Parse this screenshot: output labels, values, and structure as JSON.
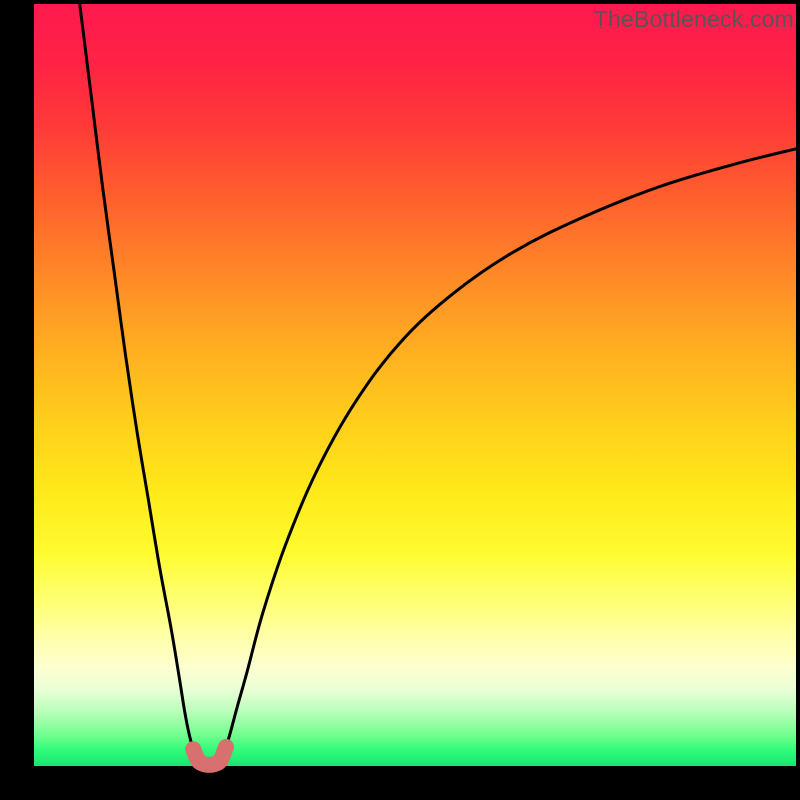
{
  "watermark": "TheBottleneck.com",
  "chart_data": {
    "type": "line",
    "title": "",
    "xlabel": "",
    "ylabel": "",
    "xlim": [
      0,
      100
    ],
    "ylim": [
      0,
      100
    ],
    "gradient_stops": [
      {
        "pct": 0,
        "color": "#ff1950"
      },
      {
        "pct": 8,
        "color": "#ff2344"
      },
      {
        "pct": 16,
        "color": "#ff3a38"
      },
      {
        "pct": 24,
        "color": "#ff5a2e"
      },
      {
        "pct": 32,
        "color": "#ff7a29"
      },
      {
        "pct": 40,
        "color": "#ff9a25"
      },
      {
        "pct": 48,
        "color": "#ffb81f"
      },
      {
        "pct": 56,
        "color": "#ffd21b"
      },
      {
        "pct": 64,
        "color": "#ffe91a"
      },
      {
        "pct": 72,
        "color": "#fffb30"
      },
      {
        "pct": 78,
        "color": "#ffff70"
      },
      {
        "pct": 83,
        "color": "#ffffa8"
      },
      {
        "pct": 87,
        "color": "#fdffd0"
      },
      {
        "pct": 90,
        "color": "#e9ffd6"
      },
      {
        "pct": 93,
        "color": "#b6ffb8"
      },
      {
        "pct": 96,
        "color": "#70ff8e"
      },
      {
        "pct": 98,
        "color": "#2dfb7a"
      },
      {
        "pct": 100,
        "color": "#19e56f"
      }
    ],
    "series": [
      {
        "name": "left-branch",
        "x": [
          6.0,
          7.5,
          9.0,
          10.5,
          12.0,
          13.5,
          15.0,
          16.5,
          18.0,
          19.0,
          19.8,
          20.4,
          20.9,
          21.3
        ],
        "values": [
          100,
          88,
          76,
          65,
          54,
          44,
          35,
          26,
          18,
          12,
          7,
          4,
          2.2,
          1.2
        ]
      },
      {
        "name": "right-branch",
        "x": [
          24.7,
          25.2,
          25.8,
          26.6,
          28.0,
          30.0,
          33.0,
          37.0,
          42.0,
          48.0,
          55.0,
          63.0,
          72.0,
          82.0,
          92.0,
          100.0
        ],
        "values": [
          1.2,
          2.5,
          4.5,
          7.5,
          12.5,
          20.0,
          29.0,
          38.5,
          47.5,
          55.5,
          62.0,
          67.5,
          72.0,
          76.0,
          79.0,
          81.0
        ]
      }
    ],
    "trough_marker": {
      "name": "trough",
      "color": "#d8706f",
      "x": [
        20.9,
        21.3,
        21.3,
        21.7,
        22.3,
        23.0,
        23.7,
        24.3,
        24.7,
        24.7,
        25.2
      ],
      "values": [
        2.2,
        1.2,
        1.2,
        0.55,
        0.25,
        0.15,
        0.25,
        0.55,
        1.2,
        1.2,
        2.5
      ]
    }
  }
}
